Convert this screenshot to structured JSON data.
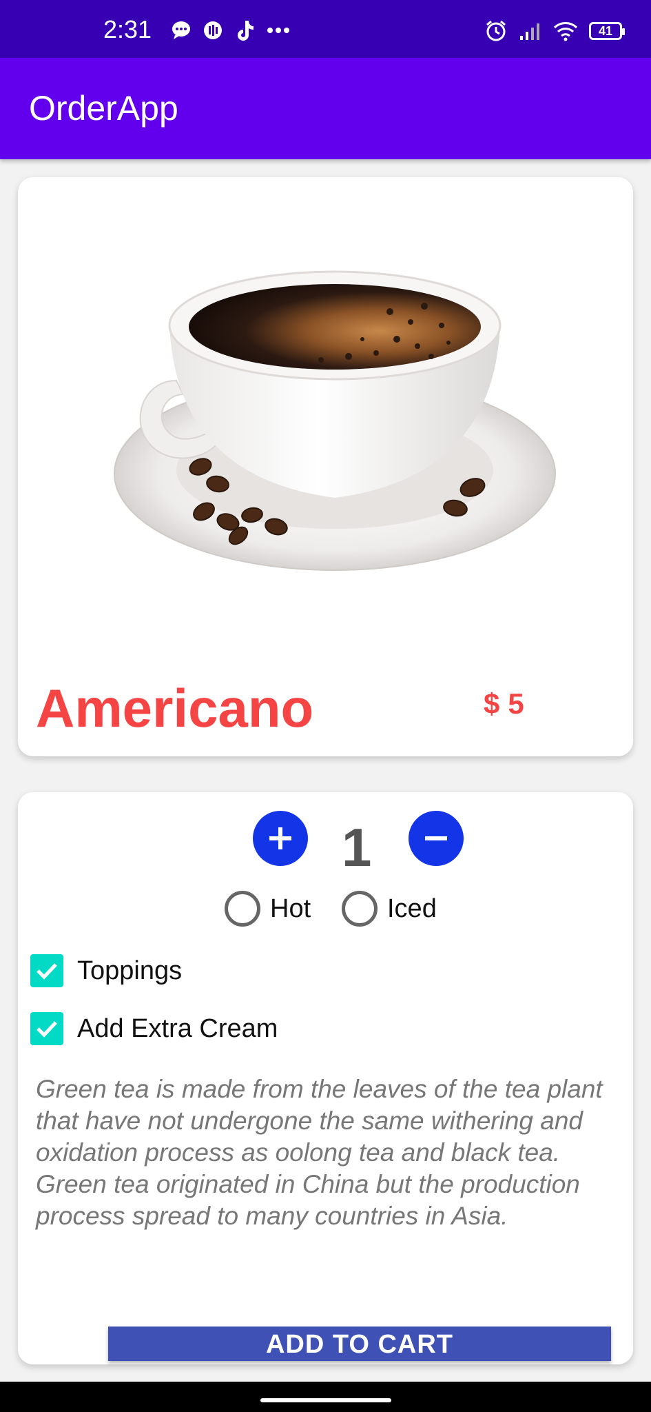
{
  "status_bar": {
    "time": "2:31",
    "icons_left": [
      "message-icon",
      "music-icon",
      "tiktok-icon",
      "more-dots-icon"
    ],
    "icons_right": [
      "alarm-icon",
      "signal-icon",
      "wifi-icon",
      "battery-icon"
    ],
    "battery": "41"
  },
  "app_bar": {
    "title": "OrderApp"
  },
  "product": {
    "name": "Americano",
    "currency": "$",
    "price": "5",
    "image": "coffee-cup-image"
  },
  "order": {
    "quantity": "1",
    "temperature_options": [
      {
        "label": "Hot",
        "selected": false
      },
      {
        "label": "Iced",
        "selected": false
      }
    ],
    "toppings_label": "Toppings",
    "toppings_checked": true,
    "extra_cream_label": "Add Extra Cream",
    "extra_cream_checked": true,
    "description": "Green tea is made from the leaves of the tea plant that have not undergone the same withering and oxidation process as oolong tea and black tea. Green tea originated in China but the production process spread to many countries in Asia.",
    "add_to_cart_label": "ADD TO CART"
  },
  "colors": {
    "status_bar": "#3700b3",
    "app_bar": "#6200ee",
    "accent_red": "#f44444",
    "round_button": "#1434e8",
    "checkbox": "#03dac5",
    "cart_button": "#3f51b5"
  }
}
